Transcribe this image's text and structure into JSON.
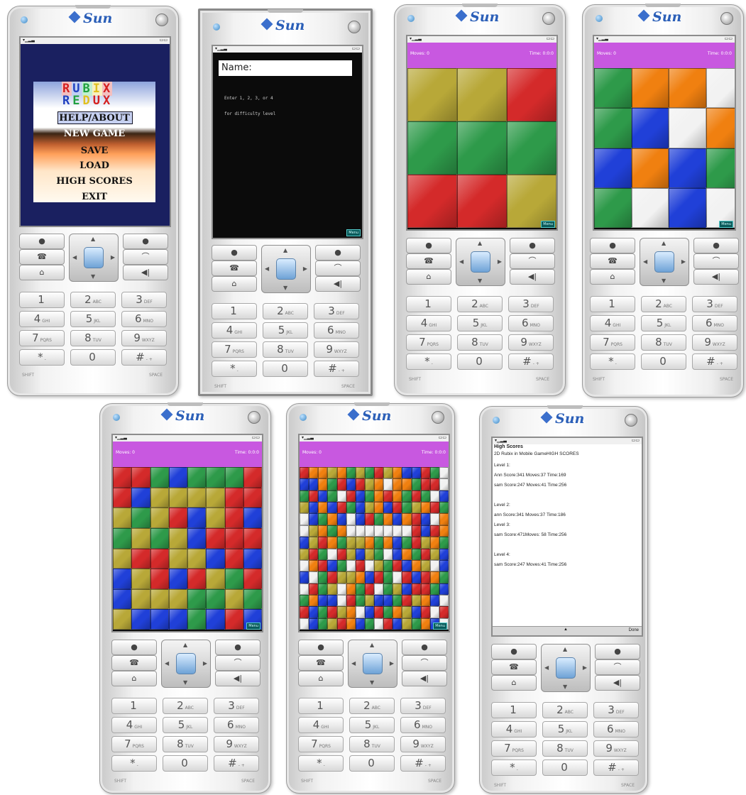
{
  "phone": {
    "brand": "Sun",
    "keys": [
      {
        "num": "1",
        "letters": ""
      },
      {
        "num": "2",
        "letters": "ABC"
      },
      {
        "num": "3",
        "letters": "DEF"
      },
      {
        "num": "4",
        "letters": "GHI"
      },
      {
        "num": "5",
        "letters": "JKL"
      },
      {
        "num": "6",
        "letters": "MNO"
      },
      {
        "num": "7",
        "letters": "PQRS"
      },
      {
        "num": "8",
        "letters": "TUV"
      },
      {
        "num": "9",
        "letters": "WXYZ"
      },
      {
        "num": "*",
        "letters": "-"
      },
      {
        "num": "0",
        "letters": ""
      },
      {
        "num": "#",
        "letters": "- +"
      }
    ],
    "shift_label": "SHIFT",
    "space_label": "SPACE"
  },
  "menu_screen": {
    "logo_line1": [
      "R",
      "U",
      "B",
      "I",
      "X"
    ],
    "logo_line2": [
      "R",
      "E",
      "D",
      "U",
      "X"
    ],
    "logo_colors": [
      "#d42020",
      "#2040c0",
      "#20a040",
      "#e0c020",
      "#d42020"
    ],
    "items": [
      "HELP/ABOUT",
      "NEW GAME",
      "SAVE",
      "LOAD",
      "HIGH SCORES",
      "EXIT"
    ]
  },
  "name_screen": {
    "name_placeholder": "Name:",
    "instruction1": "Enter 1, 2, 3, or 4",
    "instruction2": "for difficulty level",
    "command": "Menu"
  },
  "colors": {
    "Y": "#b8a838",
    "R": "#d42a2a",
    "G": "#2e9a4a",
    "O": "#f08010",
    "W": "#f2f2f2",
    "B": "#2040d8",
    "hud": "#c858e0"
  },
  "boards": [
    {
      "moves": "Moves: 0",
      "time": "Time: 0:0:0",
      "command": "Menu",
      "cols": 3,
      "grid": [
        "YYR",
        "GGG",
        "RRY"
      ]
    },
    {
      "moves": "Moves: 0",
      "time": "Time: 0:0:0",
      "command": "Menu",
      "cols": 4,
      "grid": [
        "GOOW",
        "GBWO",
        "BOBG",
        "GWBW"
      ]
    },
    {
      "moves": "Moves: 0",
      "time": "Time: 0:0:0",
      "command": "Menu",
      "cols": 8,
      "grid": [
        "RRGBGGGR",
        "RBYYYYRR",
        "YGYRBYRB",
        "GYGYBRRR",
        "YRRYYBRB",
        "BYRBRYGR",
        "BYYYGGYG",
        "YBBBGBRB"
      ]
    },
    {
      "moves": "Moves: 0",
      "time": "Time: 0:0:0",
      "command": "Menu",
      "cols": 16,
      "grid": [
        "ROOYOGYGRYOBBRGW",
        "BBOGRBRYOWOOGRRW",
        "GRBGWRBGOROGRGWB",
        "YBOBRGBYOBRGYORG",
        "WBGOBWBRGOBORBWO",
        "WYOGOWWWWWWWRBRO",
        "BYROGYYOGOBGRYOG",
        "YRGWRYBYGWBOGRYB",
        "WORBGWRWYGRBOYWB",
        "BWGRYYOBRGWRBROG",
        "WRGYWOGRWGYBRRGB",
        "GOBBWRGYBBGRYOBW",
        "RBGRYOWBRGOYBRWR",
        "WBGYROBGWRBYGOBW"
      ]
    }
  ],
  "high_scores": {
    "title": "High Scores",
    "subtitle": "2D Rubix in Mobile GameHIGH SCORES",
    "lines": [
      "Level 1:",
      "Ann Score:341 Moves:37 Time:169",
      "sam Score:247 Moves:41 Time:256",
      "",
      "Level 2:",
      "ann Score:341 Moves:37 Time:186",
      "Level 3:",
      "sam Score:471Moves: 58 Time:256",
      "",
      "Level 4:",
      "sam Score:247 Moves:41 Time:256"
    ],
    "done_label": "Done",
    "scroll_icon": "up-arrow-icon"
  }
}
